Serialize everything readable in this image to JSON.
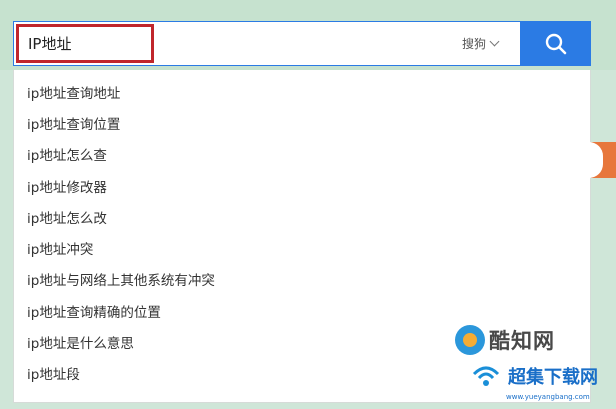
{
  "search": {
    "query": "IP地址",
    "engine": "搜狗",
    "button_icon": "search-icon"
  },
  "suggestions": [
    "ip地址查询地址",
    "ip地址查询位置",
    "ip地址怎么查",
    "ip地址修改器",
    "ip地址怎么改",
    "ip地址冲突",
    "ip地址与网络上其他系统有冲突",
    "ip地址查询精确的位置",
    "ip地址是什么意思",
    "ip地址段"
  ],
  "watermarks": {
    "logo_text": "酷知网",
    "secondary_text": "超集下载网",
    "secondary_url": "www.yueyangbang.com"
  },
  "colors": {
    "accent": "#2b7be4",
    "highlight_border": "#c0262b",
    "background": "#cfe6d8"
  }
}
